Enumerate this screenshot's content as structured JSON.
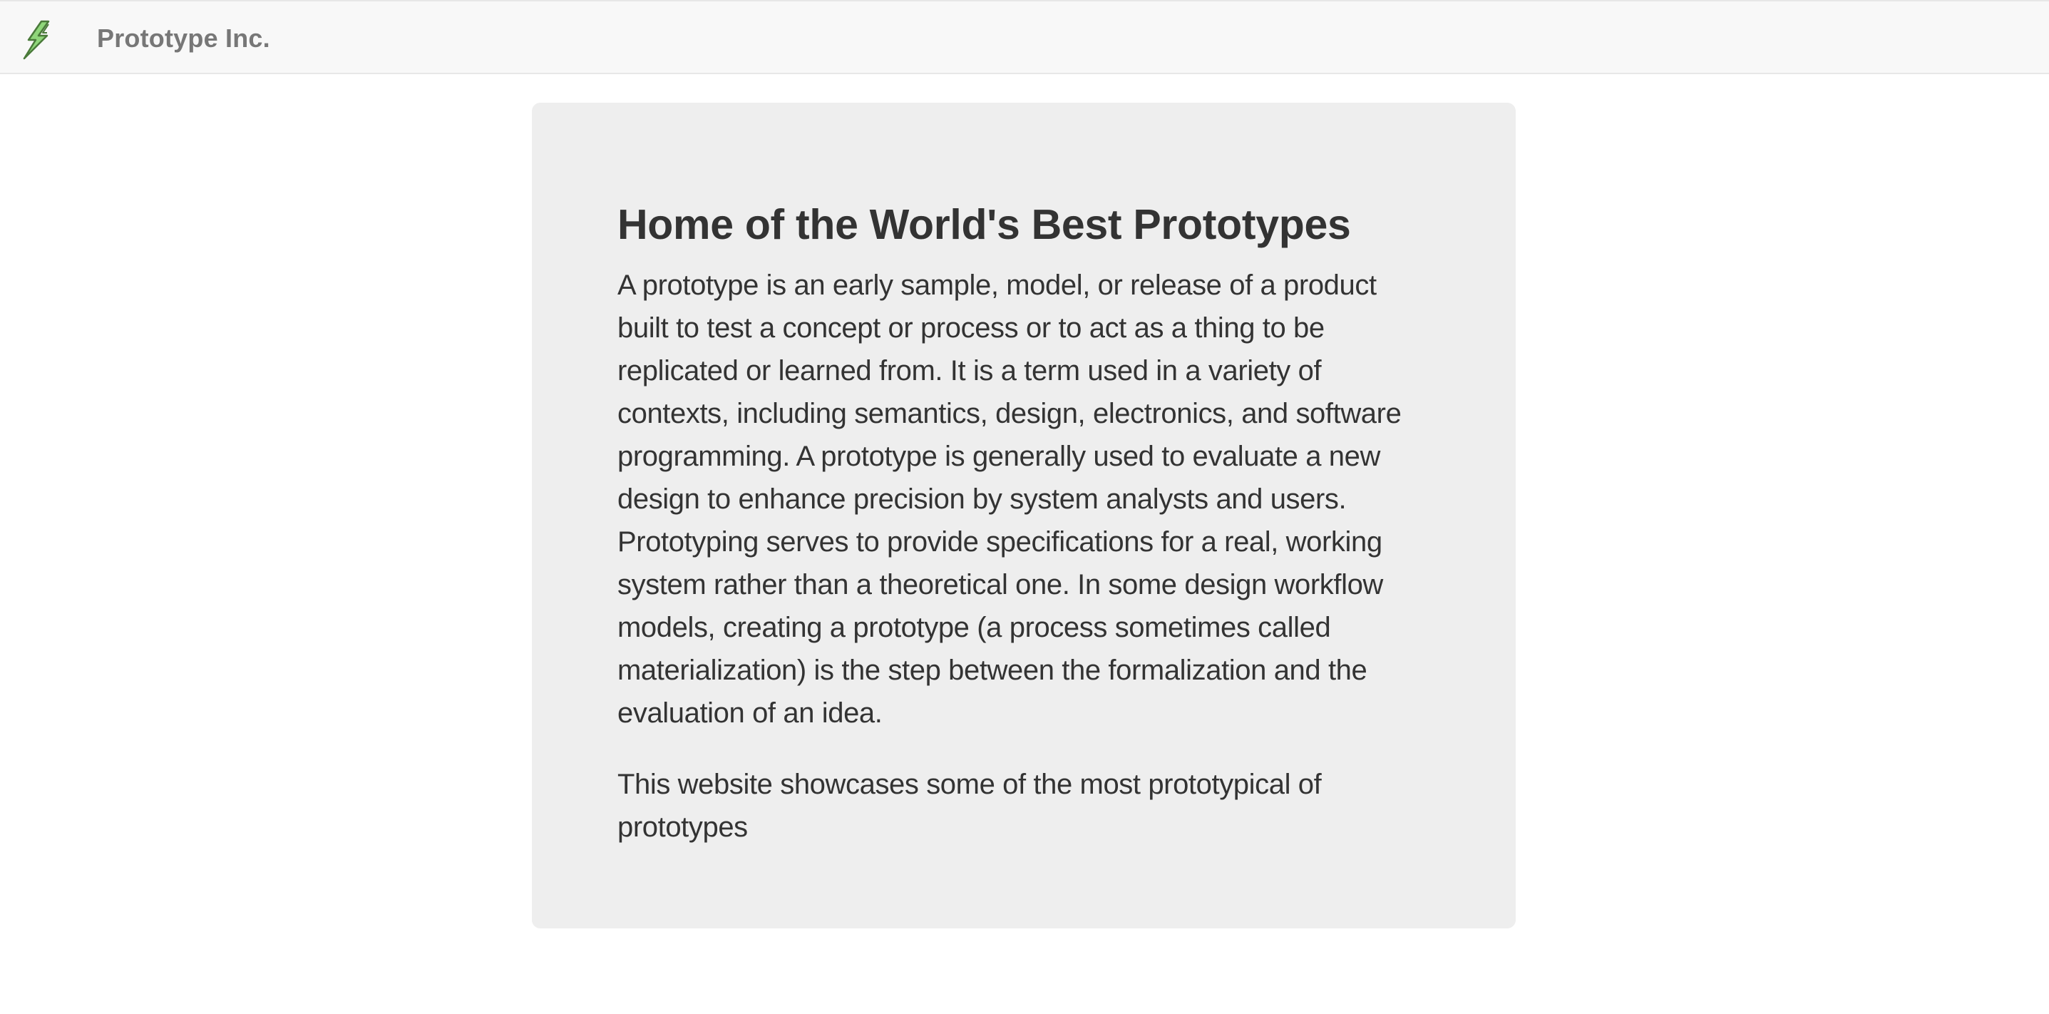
{
  "navbar": {
    "brand_name": "Prototype Inc.",
    "logo_icon": "lightning-bolt-icon",
    "logo_colors": {
      "fill": "#8fd67a",
      "stroke": "#4a7a3a"
    }
  },
  "hero": {
    "title": "Home of the World's Best Prototypes",
    "description": "A prototype is an early sample, model, or release of a product built to test a concept or process or to act as a thing to be replicated or learned from. It is a term used in a variety of contexts, including semantics, design, electronics, and software programming. A prototype is generally used to evaluate a new design to enhance precision by system analysts and users. Prototyping serves to provide specifications for a real, working system rather than a theoretical one. In some design workflow models, creating a prototype (a process sometimes called materialization) is the step between the formalization and the evaluation of an idea.",
    "tagline": "This website showcases some of the most prototypical of prototypes"
  },
  "colors": {
    "navbar_background": "#f8f8f8",
    "hero_background": "#eeeeee",
    "brand_text": "#777777",
    "body_text": "#333333"
  }
}
